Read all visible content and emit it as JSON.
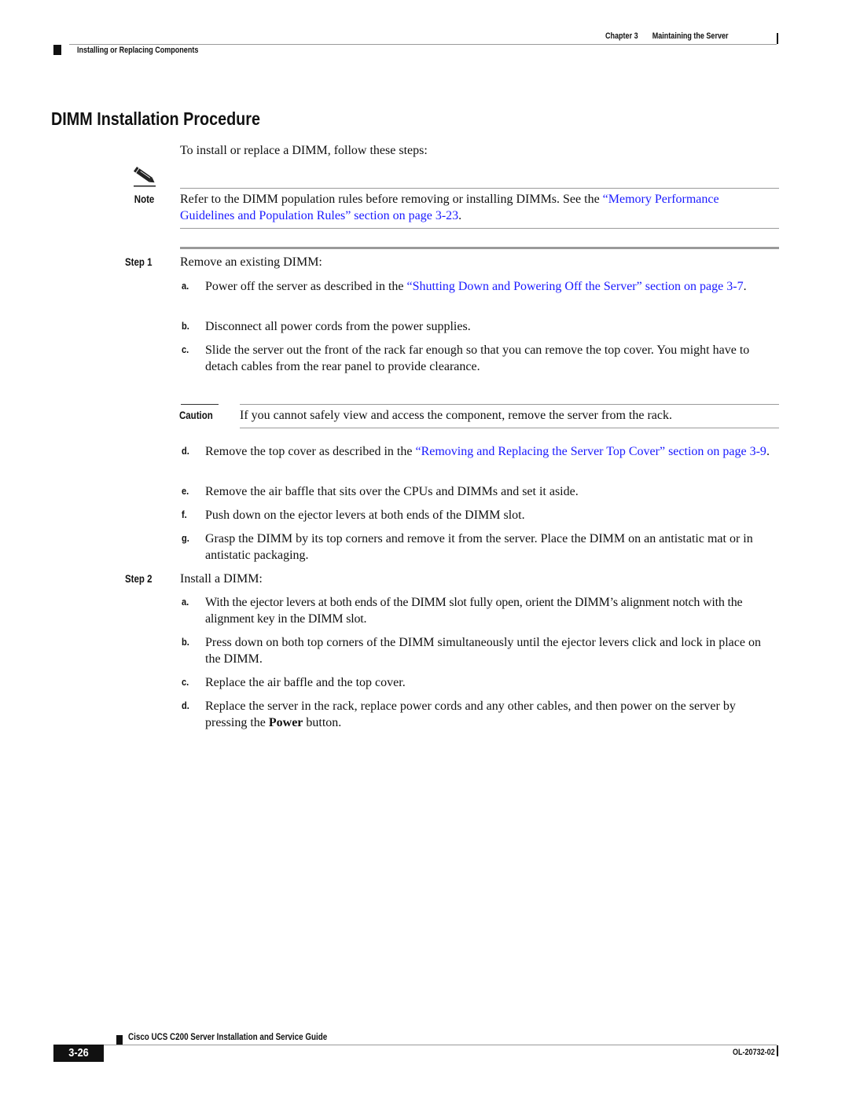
{
  "header": {
    "chapter": "Chapter 3",
    "chapter_title": "Maintaining the Server",
    "section": "Installing or Replacing Components"
  },
  "page_title": "DIMM Installation Procedure",
  "intro": "To install or replace a DIMM, follow these steps:",
  "note": {
    "label": "Note",
    "icon": "pencil-note-icon",
    "text_before": "Refer to the DIMM population rules before removing or installing DIMMs. See the ",
    "link": "“Memory Performance Guidelines and Population Rules” section on page 3-23",
    "text_after": "."
  },
  "steps": [
    {
      "label": "Step 1",
      "title": "Remove an existing DIMM:",
      "substeps": [
        {
          "letter": "a.",
          "text_before": "Power off the server as described in the ",
          "link": "“Shutting Down and Powering Off the Server” section on page 3-7",
          "text_after": "."
        },
        {
          "letter": "b.",
          "text": "Disconnect all power cords from the power supplies."
        },
        {
          "letter": "c.",
          "text": "Slide the server out the front of the rack far enough so that you can remove the top cover. You might have to detach cables from the rear panel to provide clearance."
        },
        {
          "letter": "d.",
          "text_before": "Remove the top cover as described in the ",
          "link": "“Removing and Replacing the Server Top Cover” section on page 3-9",
          "text_after": "."
        },
        {
          "letter": "e.",
          "text": "Remove the air baffle that sits over the CPUs and DIMMs and set it aside."
        },
        {
          "letter": "f.",
          "text": "Push down on the ejector levers at both ends of the DIMM slot."
        },
        {
          "letter": "g.",
          "text": "Grasp the DIMM by its top corners and remove it from the server. Place the DIMM on an antistatic mat or in antistatic packaging."
        }
      ]
    },
    {
      "label": "Step 2",
      "title": "Install a DIMM:",
      "substeps": [
        {
          "letter": "a.",
          "text": "With the ejector levers at both ends of the DIMM slot fully open, orient the DIMM’s alignment notch with the alignment key in the DIMM slot."
        },
        {
          "letter": "b.",
          "text": "Press down on both top corners of the DIMM simultaneously until the ejector levers click and lock in place on the DIMM."
        },
        {
          "letter": "c.",
          "text": "Replace the air baffle and the top cover."
        },
        {
          "letter": "d.",
          "text_before": "Replace the server in the rack, replace power cords and any other cables, and then power on the server by pressing the ",
          "bold": "Power",
          "text_after": " button."
        }
      ]
    }
  ],
  "caution": {
    "label": "Caution",
    "text": "If you cannot safely view and access the component, remove the server from the rack."
  },
  "footer": {
    "guide_title": "Cisco UCS C200 Server Installation and Service Guide",
    "page_number": "3-26",
    "doc_number": "OL-20732-02"
  },
  "colors": {
    "link": "#1a1aff",
    "rule": "#9a9a9a",
    "text": "#111111"
  }
}
